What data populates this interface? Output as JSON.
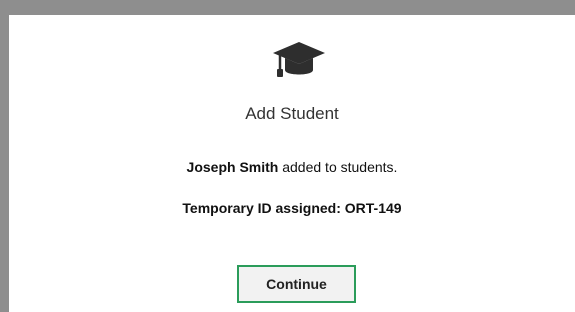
{
  "dialog": {
    "icon": "graduation-cap-icon",
    "title": "Add Student",
    "student_name": "Joseph Smith",
    "added_text": " added to students.",
    "temp_id_label": "Temporary ID assigned: ORT-149",
    "continue_label": "Continue"
  },
  "colors": {
    "frame_gray": "#8e8e8e",
    "button_border": "#2b9c5a",
    "button_bg": "#f2f2f2",
    "icon": "#2e2e2e"
  }
}
